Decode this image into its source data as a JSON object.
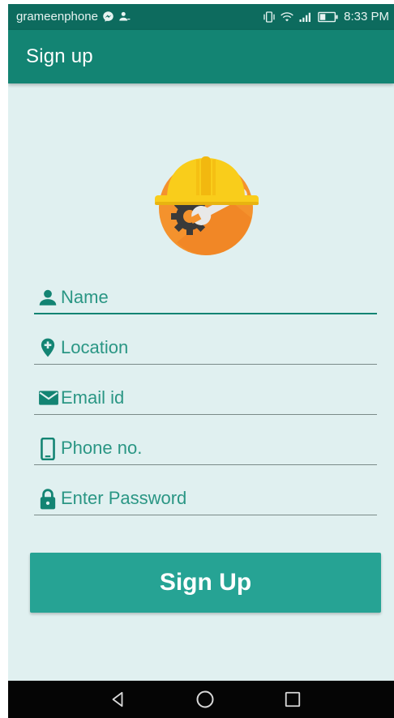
{
  "status_bar": {
    "carrier": "grameenphone",
    "time": "8:33 PM",
    "icons": [
      "messenger-icon",
      "user-notification-icon",
      "vibrate-icon",
      "wifi-icon",
      "signal-icon",
      "battery-icon"
    ]
  },
  "app_bar": {
    "title": "Sign up"
  },
  "logo": {
    "icon": "worker-helmet-wrench-logo",
    "colors": {
      "helmet": "#f9cd1b",
      "circle": "#f4922d",
      "gear": "#3a3a3a",
      "wrench": "#e8e8e8"
    }
  },
  "form": {
    "fields": [
      {
        "icon": "person-icon",
        "placeholder": "Name",
        "value": ""
      },
      {
        "icon": "location-pin-icon",
        "placeholder": "Location",
        "value": ""
      },
      {
        "icon": "email-icon",
        "placeholder": "Email id",
        "value": ""
      },
      {
        "icon": "phone-icon",
        "placeholder": "Phone no.",
        "value": ""
      },
      {
        "icon": "lock-icon",
        "placeholder": "Enter Password",
        "value": ""
      }
    ],
    "submit_label": "Sign Up"
  },
  "nav_bar": {
    "buttons": [
      "back-icon",
      "home-icon",
      "recents-icon"
    ]
  },
  "colors": {
    "status_bar": "#0d6b5e",
    "app_bar": "#138473",
    "background": "#e0f0f0",
    "accent": "#138473",
    "button": "#26a394",
    "text_accent": "#2a9684"
  }
}
